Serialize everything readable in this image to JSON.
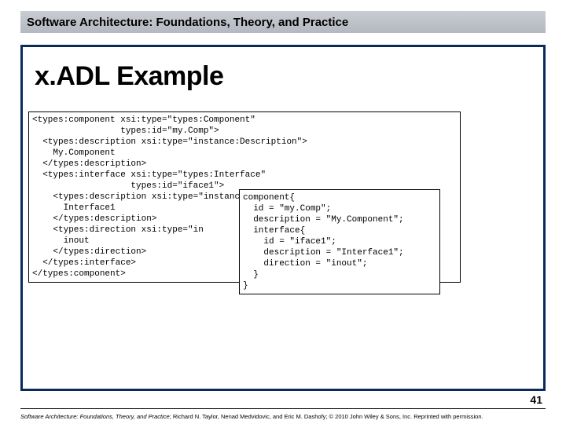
{
  "header": {
    "title": "Software Architecture: Foundations, Theory, and Practice"
  },
  "slide": {
    "title": "x.ADL Example",
    "page_number": "41"
  },
  "code": {
    "xml": "<types:component xsi:type=\"types:Component\"\n                 types:id=\"my.Comp\">\n  <types:description xsi:type=\"instance:Description\">\n    My.Component\n  </types:description>\n  <types:interface xsi:type=\"types:Interface\"\n                   types:id=\"iface1\">\n    <types:description xsi:type=\"instance:Description\">\n      Interface1\n    </types:description>\n    <types:direction xsi:type=\"in\n      inout\n    </types:direction>\n  </types:interface>\n</types:component>",
    "dsl": "component{\n  id = \"my.Comp\";\n  description = \"My.Component\";\n  interface{\n    id = \"iface1\";\n    description = \"Interface1\";\n    direction = \"inout\";\n  }\n}"
  },
  "footer": {
    "book": "Software Architecture: Foundations, Theory, and Practice",
    "rest": "; Richard N. Taylor, Nenad Medvidovic, and Eric M. Dashofy; © 2010 John Wiley & Sons, Inc. Reprinted with permission."
  }
}
